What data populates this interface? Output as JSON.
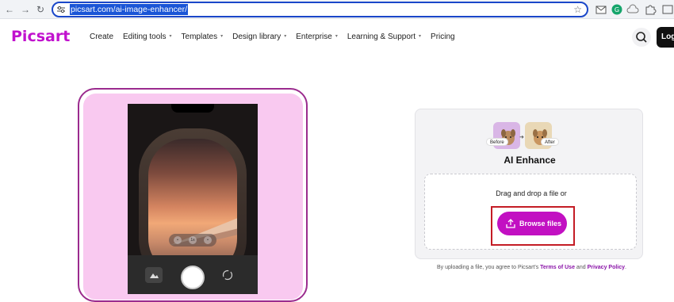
{
  "browser": {
    "url": "picsart.com/ai-image-enhancer/",
    "nav_back_icon": "arrow-left-icon",
    "nav_forward_icon": "arrow-right-icon",
    "reload_icon": "reload-icon",
    "extensions": [
      "gmail-icon",
      "grammarly-icon",
      "cloud-icon",
      "puzzle-icon",
      "window-icon"
    ]
  },
  "header": {
    "logo": "Picsart",
    "brand_color": "#c112ce",
    "menu": [
      {
        "label": "Create",
        "dropdown": false
      },
      {
        "label": "Editing tools",
        "dropdown": true
      },
      {
        "label": "Templates",
        "dropdown": true
      },
      {
        "label": "Design library",
        "dropdown": true
      },
      {
        "label": "Enterprise",
        "dropdown": true
      },
      {
        "label": "Learning & Support",
        "dropdown": true
      },
      {
        "label": "Pricing",
        "dropdown": false
      }
    ],
    "login_label": "Log"
  },
  "hero": {
    "mockup_buttons": [
      "•",
      "1x",
      "•"
    ]
  },
  "upload_card": {
    "before_label": "Before",
    "after_label": "After",
    "title": "AI Enhance",
    "drop_text": "Drag and drop a file or",
    "browse_label": "Browse files",
    "browse_color": "#c210c2",
    "highlight_color": "#c41c25"
  },
  "terms": {
    "prefix": "By uploading a file, you agree to Picsart's ",
    "terms_link": "Terms of Use",
    "and": " and ",
    "privacy_link": "Privacy Policy",
    "suffix": "."
  }
}
